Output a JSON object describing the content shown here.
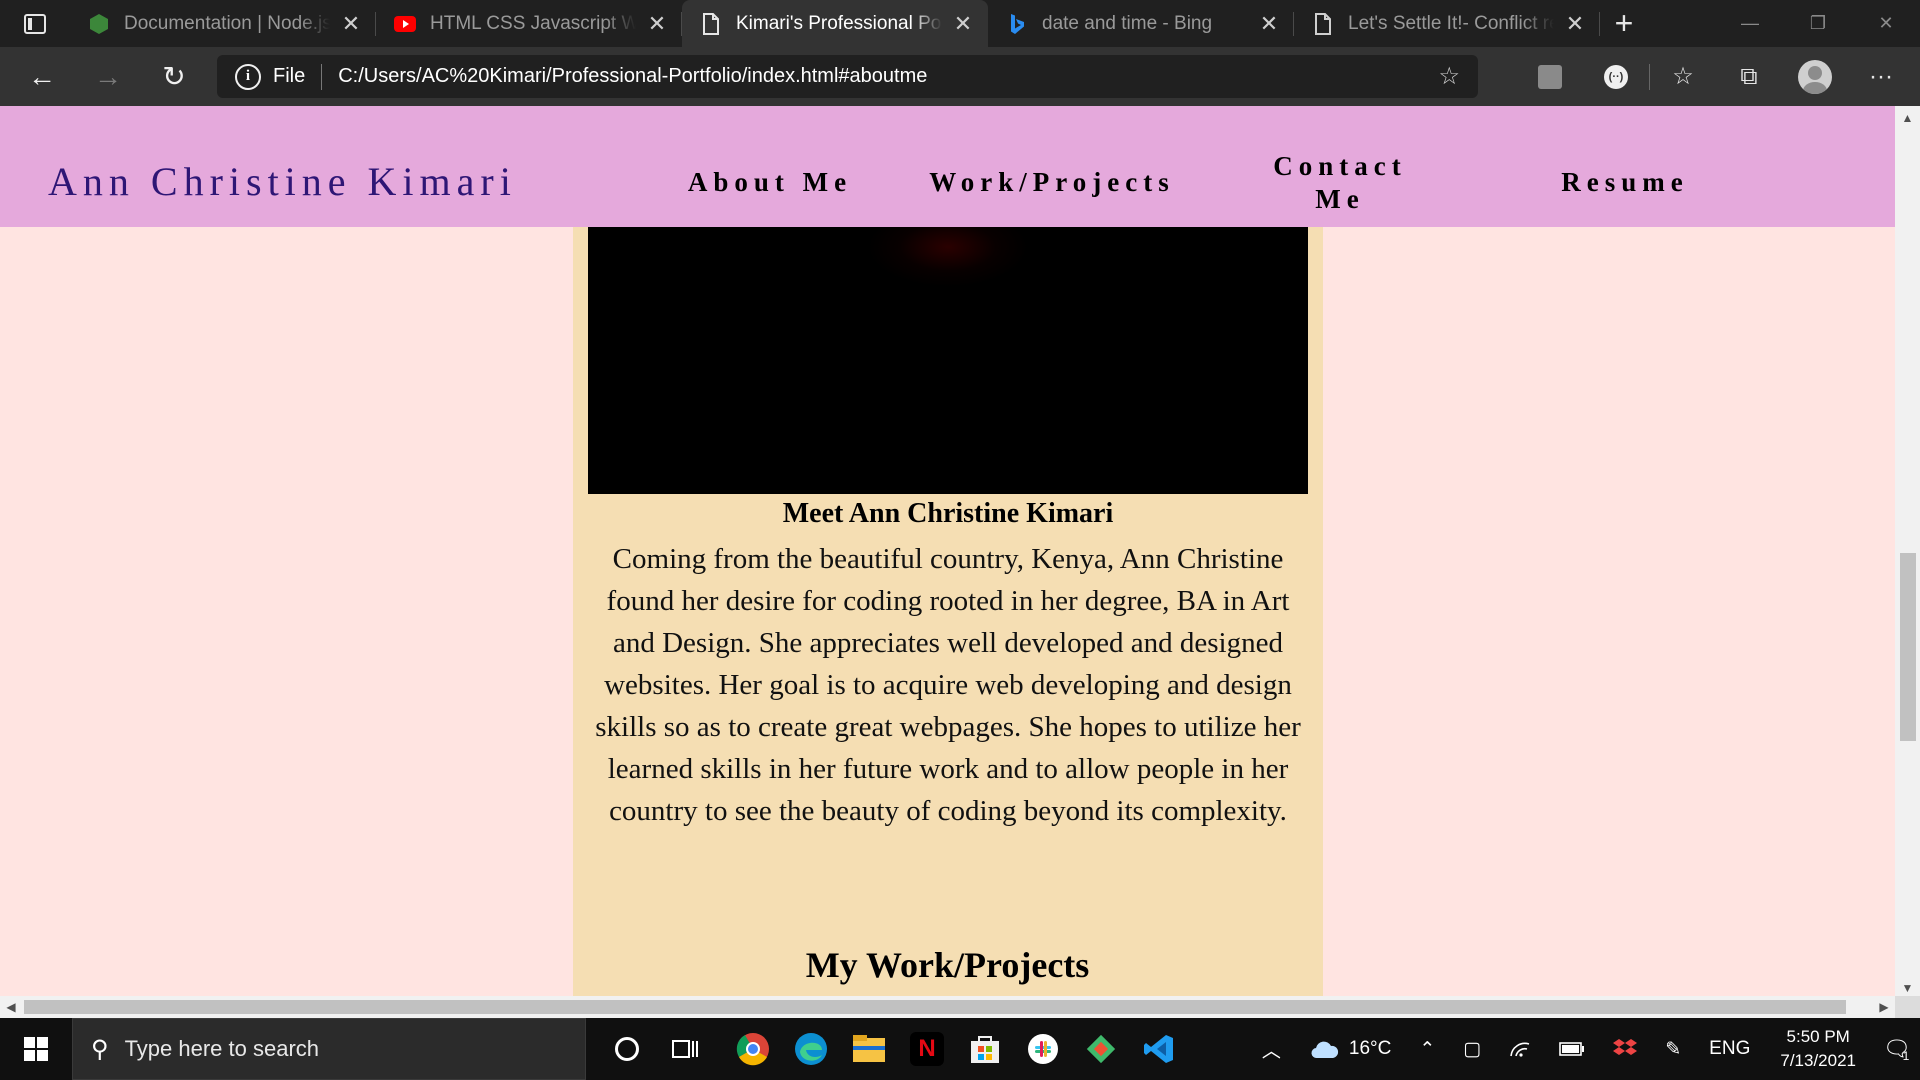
{
  "browser": {
    "tabs": [
      {
        "title": "Documentation | Node.js",
        "favicon": "nodejs-icon",
        "active": false
      },
      {
        "title": "HTML CSS Javascript Web",
        "favicon": "youtube-icon",
        "active": false
      },
      {
        "title": "Kimari's Professional Portf",
        "favicon": "page-icon",
        "active": true
      },
      {
        "title": "date and time - Bing",
        "favicon": "bing-icon",
        "active": false
      },
      {
        "title": "Let's Settle It!- Conflict res",
        "favicon": "page-icon",
        "active": false
      }
    ],
    "new_tab_glyph": "+",
    "close_glyph": "✕",
    "window_controls": {
      "minimize": "—",
      "restore": "❐",
      "close": "✕"
    }
  },
  "toolbar": {
    "back_glyph": "←",
    "forward_glyph": "→",
    "reload_glyph": "↻",
    "scheme_label": "File",
    "url": "C:/Users/AC%20Kimari/Professional-Portfolio/index.html#aboutme",
    "favorites_add_glyph": "☆",
    "favorites_glyph": "☆",
    "collections_glyph": "⧉",
    "more_glyph": "···"
  },
  "site": {
    "brand": "Ann Christine Kimari",
    "nav": {
      "about": "About Me",
      "work": "Work/Projects",
      "contact": "Contact Me",
      "resume": "Resume"
    },
    "about": {
      "heading": "Meet Ann Christine Kimari",
      "body": "Coming from the beautiful country, Kenya, Ann Christine found her desire for coding rooted in her degree, BA in Art and Design. She appreciates well developed and designed websites. Her goal is to acquire web developing and design skills so as to create great webpages. She hopes to utilize her learned skills in her future work and to allow people in her country to see the beauty of coding beyond its complexity."
    },
    "projects_heading": "My Work/Projects"
  },
  "taskbar": {
    "search_placeholder": "Type here to search",
    "apps": [
      "chrome-icon",
      "edge-icon",
      "file-explorer-icon",
      "netflix-icon",
      "microsoft-store-icon",
      "slack-icon",
      "git-icon",
      "vscode-icon"
    ],
    "weather": "16°C",
    "language": "ENG",
    "time": "5:50 PM",
    "date": "7/13/2021",
    "notification_count": "1"
  },
  "colors": {
    "nav_background": "#e5a9dc",
    "brand_text": "#2e1675",
    "about_band": "#ffe4e1",
    "about_card": "#f5deb3"
  }
}
